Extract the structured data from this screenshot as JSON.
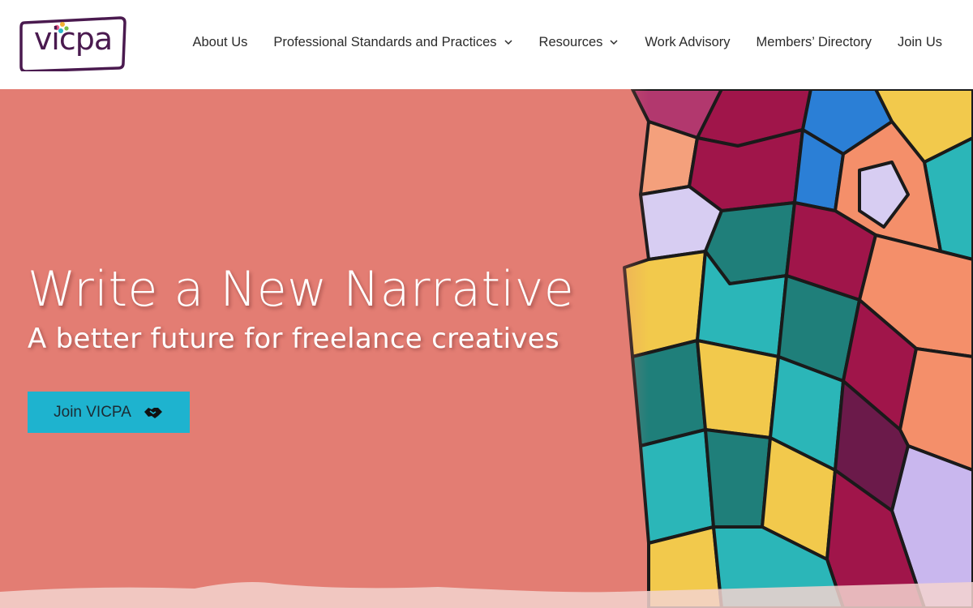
{
  "brand": {
    "logo_text": "vicpa",
    "logo_color": "#4a1a4f"
  },
  "nav": {
    "items": [
      {
        "label": "About Us",
        "has_dropdown": false
      },
      {
        "label": "Professional Standards and Practices",
        "has_dropdown": true
      },
      {
        "label": "Resources",
        "has_dropdown": true
      },
      {
        "label": "Work Advisory",
        "has_dropdown": false
      },
      {
        "label": "Members’ Directory",
        "has_dropdown": false
      },
      {
        "label": "Join Us",
        "has_dropdown": false
      }
    ]
  },
  "hero": {
    "title": "Write a New Narrative",
    "subtitle": "A better future for freelance creatives",
    "cta_label": "Join VICPA",
    "cta_icon": "handshake-icon",
    "background_color": "#e37d73",
    "cta_color": "#1eb3cf"
  }
}
